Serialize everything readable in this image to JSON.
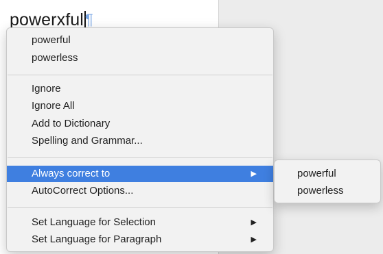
{
  "document": {
    "text": "powerxful",
    "pilcrow": "¶"
  },
  "context_menu": {
    "suggestions": [
      "powerful",
      "powerless"
    ],
    "spelling_actions": [
      "Ignore",
      "Ignore All",
      "Add to Dictionary",
      "Spelling and Grammar..."
    ],
    "autocorrect": {
      "always_correct_label": "Always correct to",
      "options_label": "AutoCorrect Options..."
    },
    "language": {
      "selection_label": "Set Language for Selection",
      "paragraph_label": "Set Language for Paragraph"
    },
    "submenu_arrow": "▶",
    "selected_color": "#3f7fe0"
  },
  "submenu": {
    "items": [
      "powerful",
      "powerless"
    ]
  }
}
